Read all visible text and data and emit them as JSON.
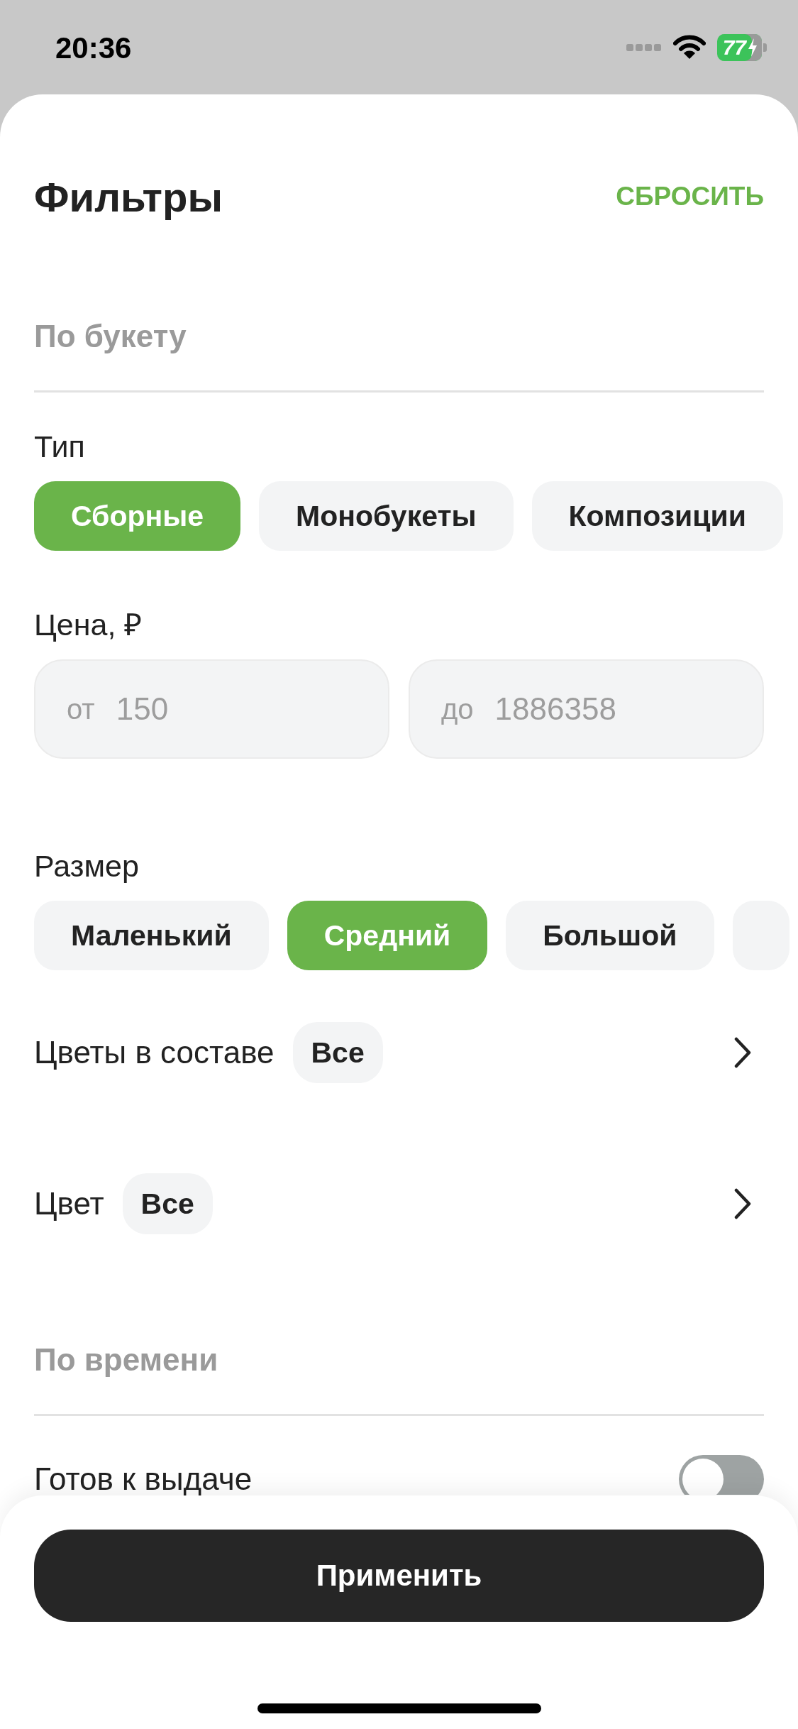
{
  "status_bar": {
    "time": "20:36",
    "battery": "77"
  },
  "header": {
    "title": "Фильтры",
    "reset": "СБРОСИТЬ"
  },
  "bouquet_section": {
    "title": "По букету"
  },
  "type": {
    "label": "Тип",
    "chips": [
      {
        "label": "Сборные",
        "selected": true
      },
      {
        "label": "Монобукеты",
        "selected": false
      },
      {
        "label": "Композиции",
        "selected": false
      }
    ]
  },
  "price": {
    "label": "Цена, ₽",
    "from": {
      "prefix": "от",
      "placeholder": "150"
    },
    "to": {
      "prefix": "до",
      "placeholder": "1886358"
    }
  },
  "size": {
    "label": "Размер",
    "chips": [
      {
        "label": "Маленький",
        "selected": false
      },
      {
        "label": "Средний",
        "selected": true
      },
      {
        "label": "Большой",
        "selected": false
      }
    ]
  },
  "nav_rows": [
    {
      "label": "Цветы в составе",
      "value": "Все"
    },
    {
      "label": "Цвет",
      "value": "Все"
    }
  ],
  "time_section": {
    "title": "По времени"
  },
  "toggles": [
    {
      "label": "Готов к выдаче",
      "on": false
    }
  ],
  "apply_button": "Применить"
}
